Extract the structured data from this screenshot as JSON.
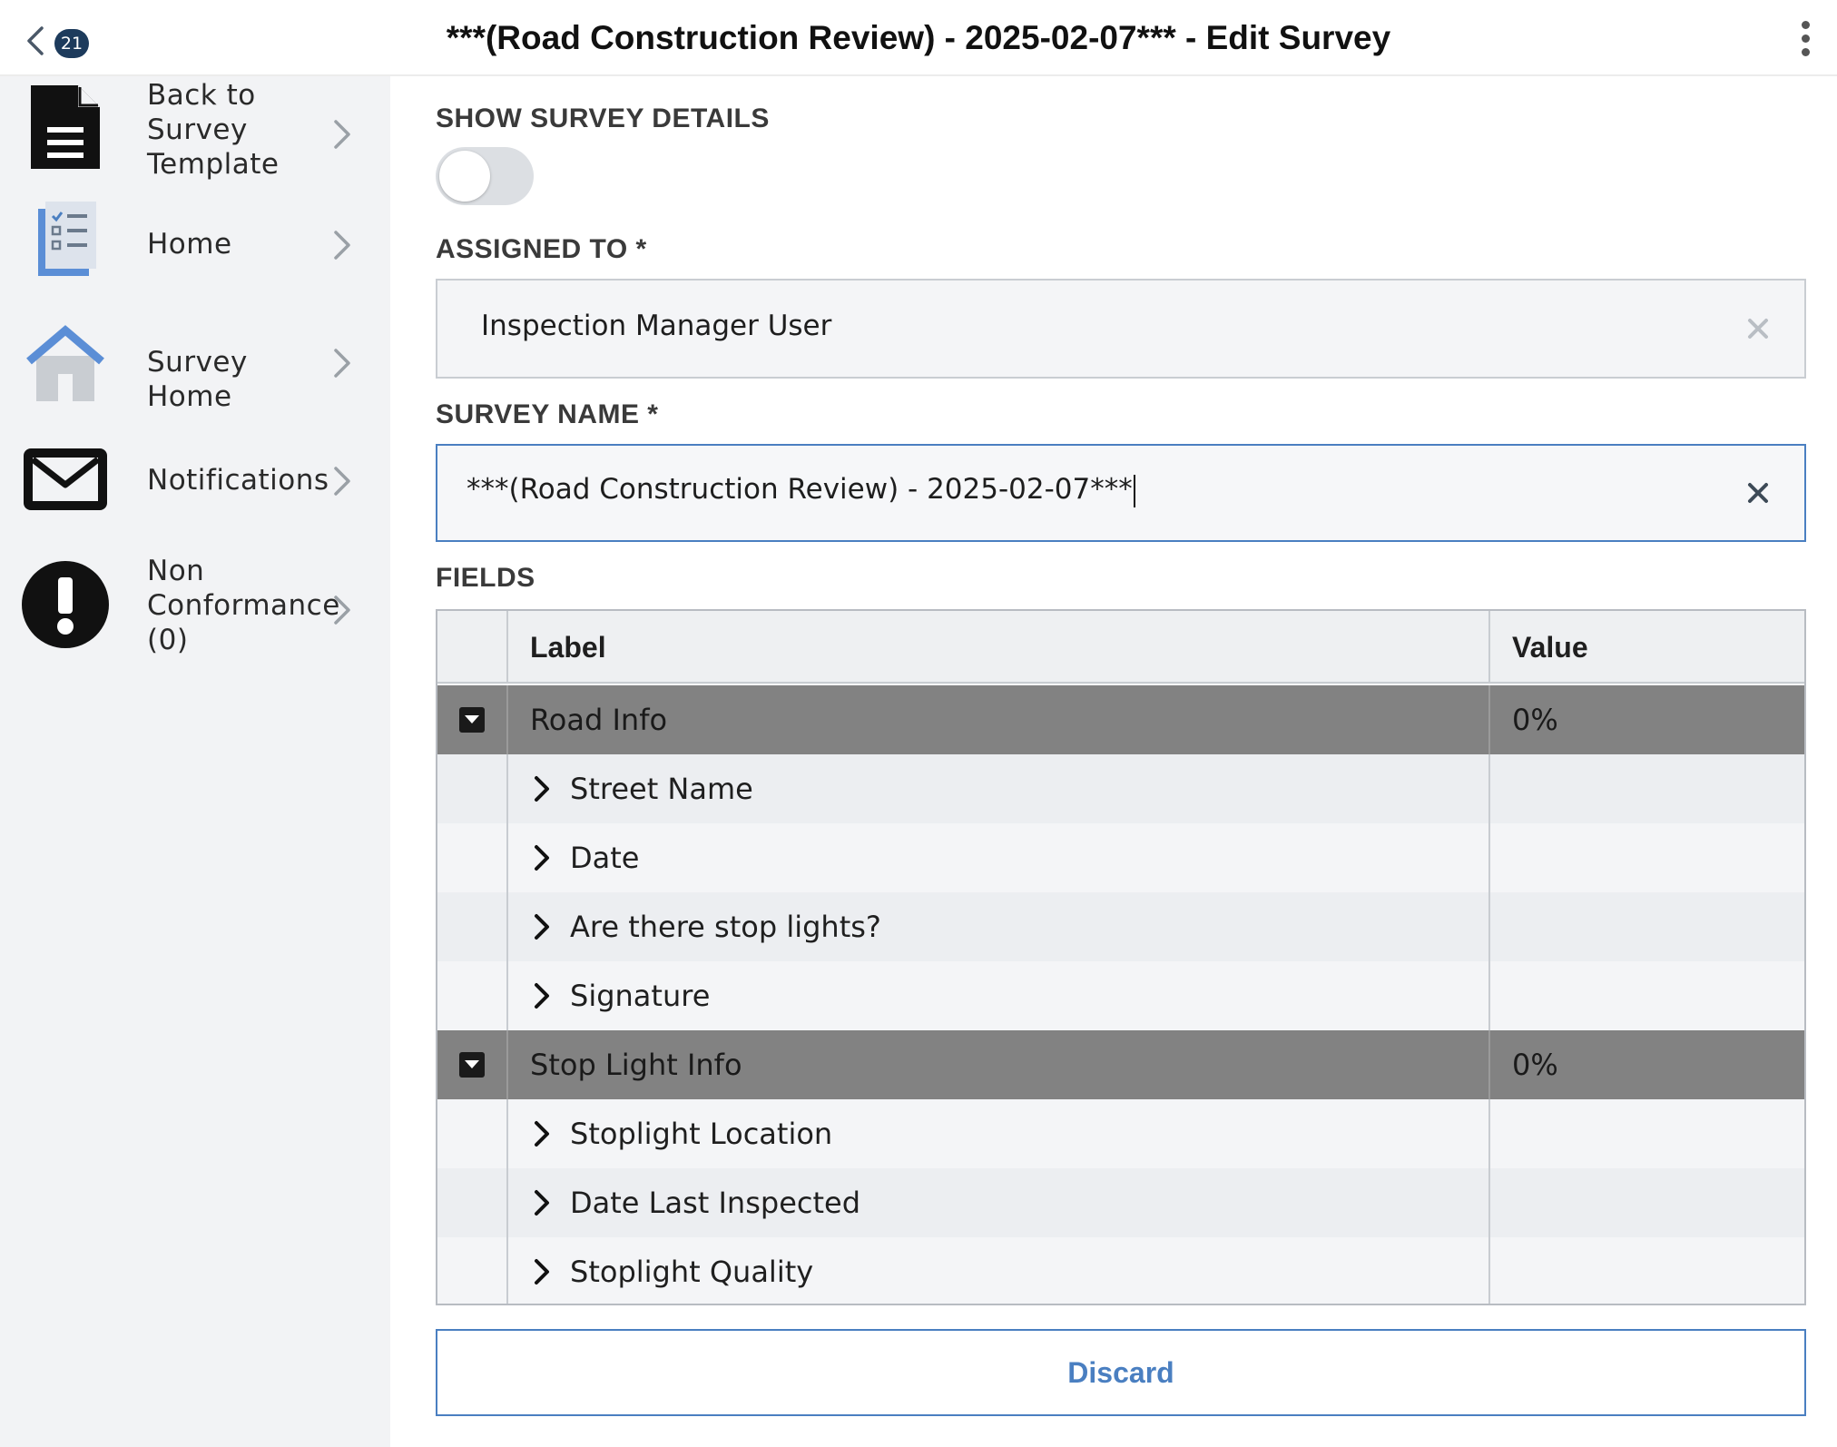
{
  "header": {
    "badge_count": "21",
    "title": "***(Road Construction Review) - 2025-02-07*** - Edit Survey"
  },
  "sidebar": {
    "items": [
      {
        "label_lines": [
          "Back to",
          "Survey",
          "Template"
        ],
        "icon": "document-icon"
      },
      {
        "label_lines": [
          "Home"
        ],
        "icon": "checklist-icon"
      },
      {
        "label_lines": [
          "Survey Home"
        ],
        "icon": "house-icon"
      },
      {
        "label_lines": [
          "Notifications"
        ],
        "icon": "envelope-icon"
      },
      {
        "label_lines": [
          "Non",
          "Conformance",
          "(0)"
        ],
        "icon": "exclamation-icon"
      }
    ]
  },
  "form": {
    "show_details_label": "SHOW SURVEY DETAILS",
    "assigned_to_label": "ASSIGNED TO *",
    "assigned_to_value": "Inspection Manager User",
    "survey_name_label": "SURVEY NAME *",
    "survey_name_value": "***(Road Construction Review) - 2025-02-07***",
    "fields_label": "FIELDS"
  },
  "table": {
    "headers": {
      "label": "Label",
      "value": "Value"
    },
    "groups": [
      {
        "label": "Road Info",
        "value": "0%",
        "items": [
          "Street Name",
          "Date",
          "Are there stop lights?",
          "Signature"
        ]
      },
      {
        "label": "Stop Light Info",
        "value": "0%",
        "items": [
          "Stoplight Location",
          "Date Last Inspected",
          "Stoplight Quality"
        ]
      }
    ]
  },
  "actions": {
    "discard_label": "Discard"
  },
  "colors": {
    "accent": "#4a7fc1",
    "group_row": "#828282",
    "badge": "#1d3b5c"
  }
}
